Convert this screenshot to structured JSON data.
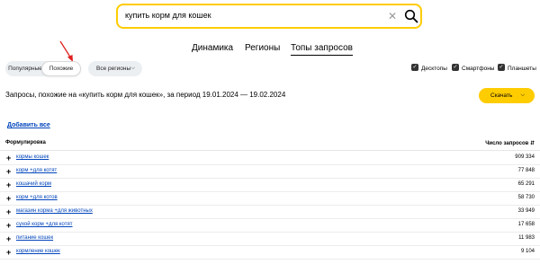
{
  "search": {
    "value": "купить корм для кошек",
    "clear_icon": "close-icon",
    "search_icon": "search-icon"
  },
  "tabs": [
    {
      "label": "Динамика",
      "active": false
    },
    {
      "label": "Регионы",
      "active": false
    },
    {
      "label": "Топы запросов",
      "active": true
    }
  ],
  "segments": {
    "popular": "Популярные",
    "similar": "Похожие",
    "selected": "similar"
  },
  "regions": {
    "label": "Все регионы"
  },
  "devices": [
    {
      "label": "Десктопы",
      "checked": true
    },
    {
      "label": "Смартфоны",
      "checked": true
    },
    {
      "label": "Планшеты",
      "checked": true
    }
  ],
  "heading": "Запросы, похожие на «купить корм для кошек», за период 19.01.2024 — 19.02.2024",
  "download": {
    "label": "Скачать"
  },
  "add_all": "Добавить все",
  "table": {
    "col_phrase": "Формулировка",
    "col_count": "Число запросов ⇵",
    "rows": [
      {
        "phrase": "кормы кошек",
        "count": "909 334"
      },
      {
        "phrase": "корм +для котят",
        "count": "77 848"
      },
      {
        "phrase": "кошачий корм",
        "count": "65 291"
      },
      {
        "phrase": "корм +для котов",
        "count": "58 730"
      },
      {
        "phrase": "магазин корма +для животных",
        "count": "33 949"
      },
      {
        "phrase": "сухой корм +для котят",
        "count": "17 658"
      },
      {
        "phrase": "питание кошек",
        "count": "11 983"
      },
      {
        "phrase": "кормление кошек",
        "count": "9 104"
      }
    ]
  },
  "colors": {
    "accent_yellow": "#ffcc00",
    "link_blue": "#0044bb",
    "annotation_red": "#e02020"
  }
}
